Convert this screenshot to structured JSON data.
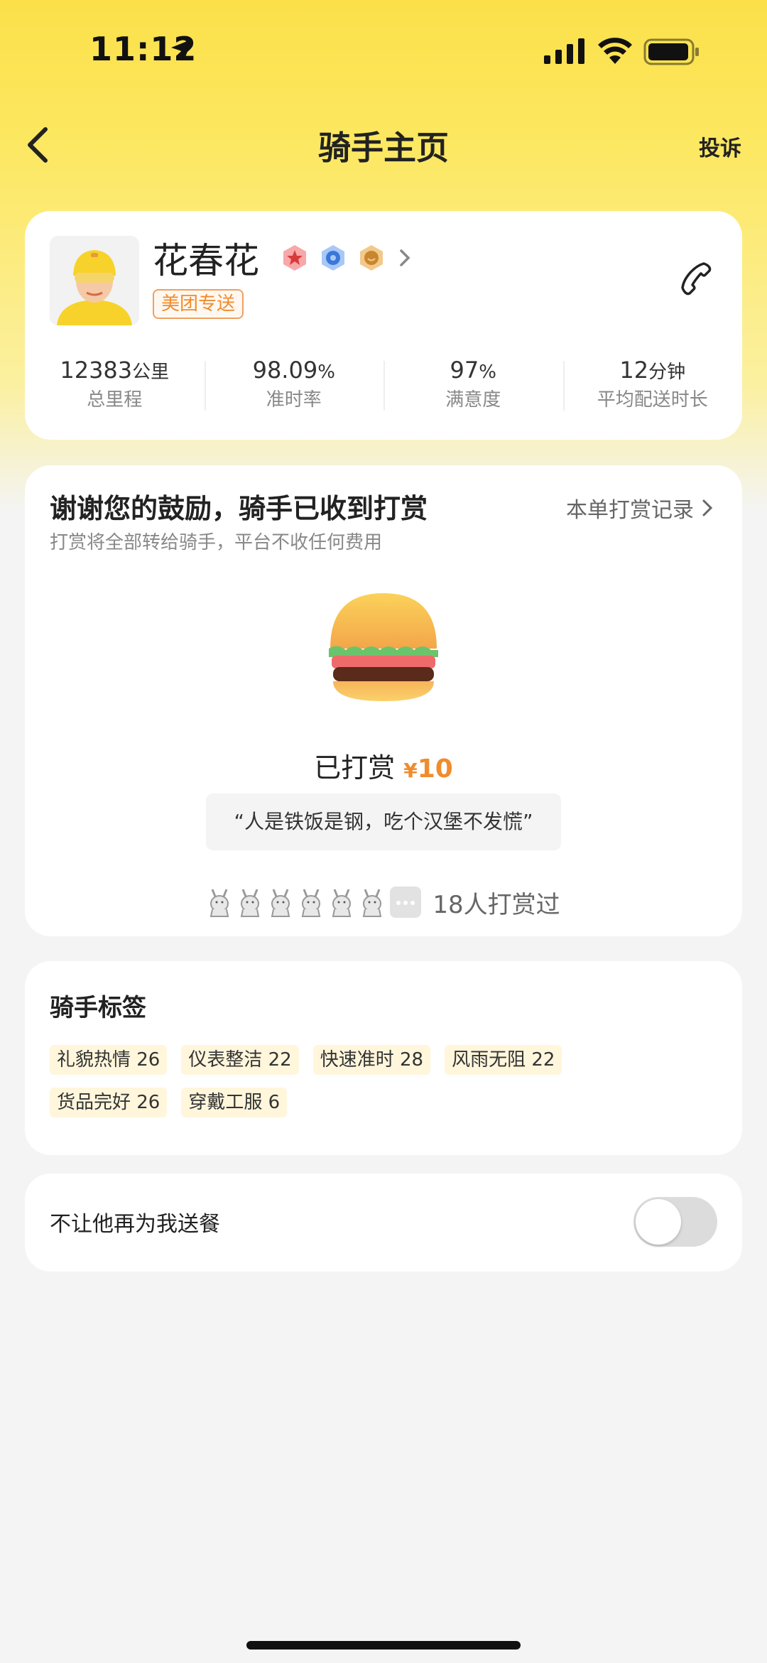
{
  "status_bar": {
    "time": "11:12"
  },
  "nav": {
    "title": "骑手主页",
    "complain": "投诉"
  },
  "rider": {
    "name": "花春花",
    "brand_tag": "美团专送",
    "badges": [
      "red-star-badge",
      "blue-badge",
      "bronze-badge"
    ],
    "stats": [
      {
        "value": "12383",
        "unit": "公里",
        "label": "总里程"
      },
      {
        "value": "98.09",
        "unit": "%",
        "label": "准时率"
      },
      {
        "value": "97",
        "unit": "%",
        "label": "满意度"
      },
      {
        "value": "12",
        "unit": "分钟",
        "label": "平均配送时长"
      }
    ]
  },
  "tip": {
    "title": "谢谢您的鼓励，骑手已收到打赏",
    "subtitle": "打赏将全部转给骑手，平台不收任何费用",
    "record_link": "本单打赏记录",
    "tipped_label": "已打赏",
    "currency": "¥",
    "amount": "10",
    "quote": "“人是铁饭是钢，吃个汉堡不发慌”",
    "tipper_count": "18人打赏过"
  },
  "tags": {
    "title": "骑手标签",
    "items": [
      "礼貌热情 26",
      "仪表整洁 22",
      "快速准时 28",
      "风雨无阻 22",
      "货品完好 26",
      "穿戴工服 6"
    ]
  },
  "block": {
    "label": "不让他再为我送餐",
    "enabled": false
  },
  "colors": {
    "accent": "#f08c2e",
    "brand_yellow": "#fbe049"
  }
}
